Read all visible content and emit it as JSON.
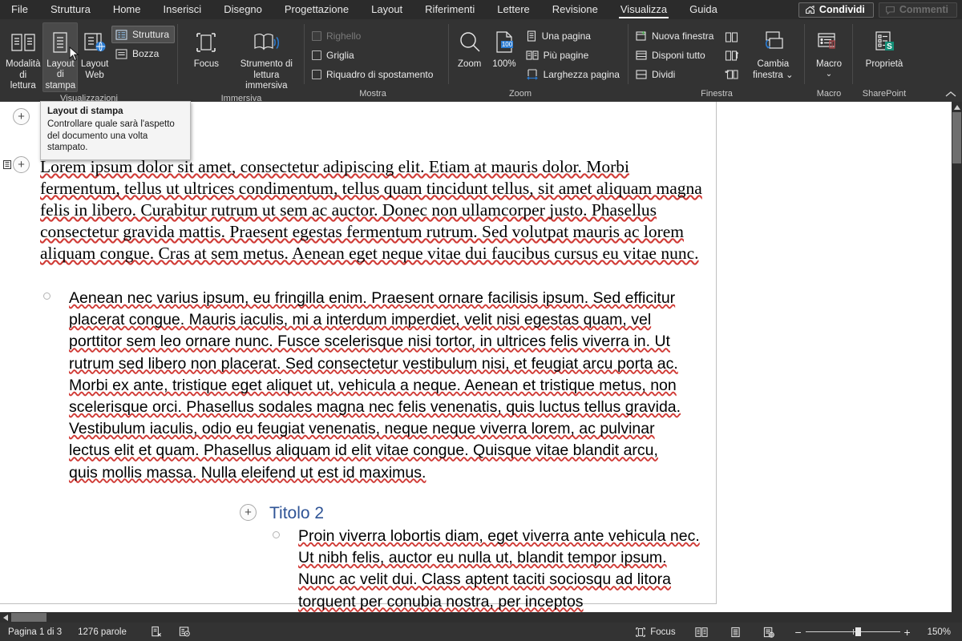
{
  "menu": {
    "tabs": [
      {
        "label": "File",
        "active": false
      },
      {
        "label": "Struttura",
        "active": false
      },
      {
        "label": "Home",
        "active": false
      },
      {
        "label": "Inserisci",
        "active": false
      },
      {
        "label": "Disegno",
        "active": false
      },
      {
        "label": "Progettazione",
        "active": false
      },
      {
        "label": "Layout",
        "active": false
      },
      {
        "label": "Riferimenti",
        "active": false
      },
      {
        "label": "Lettere",
        "active": false
      },
      {
        "label": "Revisione",
        "active": false
      },
      {
        "label": "Visualizza",
        "active": true
      },
      {
        "label": "Guida",
        "active": false
      }
    ],
    "share_label": "Condividi",
    "comments_label": "Commenti"
  },
  "ribbon": {
    "groups": [
      {
        "name": "Visualizzazioni",
        "label": "Visualizzazioni",
        "big_buttons": [
          {
            "label_line1": "Modalità",
            "label_line2": "di lettura",
            "icon": "read-mode-icon"
          },
          {
            "label_line1": "Layout di",
            "label_line2": "stampa",
            "icon": "print-layout-icon",
            "hover": true
          },
          {
            "label_line1": "Layout",
            "label_line2": "Web",
            "icon": "web-layout-icon"
          }
        ],
        "small_buttons": [
          {
            "label": "Struttura",
            "icon": "outline-icon",
            "selected": true,
            "disabled": false
          },
          {
            "label": "Bozza",
            "icon": "draft-icon",
            "selected": false,
            "disabled": false
          }
        ]
      },
      {
        "name": "Immersiva",
        "label": "Immersiva",
        "big_buttons": [
          {
            "label_line1": "Focus",
            "label_line2": "",
            "icon": "focus-icon"
          },
          {
            "label_line1": "Strumento di",
            "label_line2": "lettura immersiva",
            "icon": "immersive-reader-icon"
          }
        ],
        "small_buttons": []
      },
      {
        "name": "Mostra",
        "label": "Mostra",
        "big_buttons": [],
        "small_buttons": [
          {
            "label": "Righello",
            "icon": "checkbox",
            "selected": false,
            "disabled": true
          },
          {
            "label": "Griglia",
            "icon": "checkbox",
            "selected": false,
            "disabled": false
          },
          {
            "label": "Riquadro di spostamento",
            "icon": "checkbox",
            "selected": false,
            "disabled": false
          }
        ]
      },
      {
        "name": "Zoom",
        "label": "Zoom",
        "big_buttons": [
          {
            "label_line1": "Zoom",
            "label_line2": "",
            "icon": "magnifier-icon"
          },
          {
            "label_line1": "100%",
            "label_line2": "",
            "icon": "zoom-100-icon"
          }
        ],
        "small_buttons": [
          {
            "label": "Una pagina",
            "icon": "one-page-icon",
            "selected": false,
            "disabled": false
          },
          {
            "label": "Più pagine",
            "icon": "multi-page-icon",
            "selected": false,
            "disabled": false
          },
          {
            "label": "Larghezza pagina",
            "icon": "page-width-icon",
            "selected": false,
            "disabled": false
          }
        ]
      },
      {
        "name": "Finestra",
        "label": "Finestra",
        "big_buttons": [
          {
            "label_line1": "Cambia",
            "label_line2": "finestra ⌄",
            "icon": "switch-window-icon"
          }
        ],
        "small_buttons": [
          {
            "label": "Nuova finestra",
            "icon": "new-window-icon",
            "selected": false,
            "disabled": false
          },
          {
            "label": "Disponi tutto",
            "icon": "arrange-all-icon",
            "selected": false,
            "disabled": false
          },
          {
            "label": "Dividi",
            "icon": "split-icon",
            "selected": false,
            "disabled": false
          }
        ],
        "mini_icons": [
          "view-side-by-side-icon",
          "synchronous-scrolling-icon",
          "reset-window-position-icon"
        ]
      },
      {
        "name": "Macro",
        "label": "Macro",
        "big_buttons": [
          {
            "label_line1": "Macro",
            "label_line2": "⌄",
            "icon": "macro-icon"
          }
        ],
        "small_buttons": []
      },
      {
        "name": "SharePoint",
        "label": "SharePoint",
        "big_buttons": [
          {
            "label_line1": "Proprietà",
            "label_line2": "",
            "icon": "properties-icon"
          }
        ],
        "small_buttons": []
      }
    ]
  },
  "tooltip": {
    "title": "Layout di stampa",
    "body": "Controllare quale sarà l'aspetto del documento una volta stampato."
  },
  "document": {
    "paragraph1": "Lorem ipsum dolor sit amet, consectetur adipiscing elit. Etiam at mauris dolor. Morbi fermentum, tellus ut ultrices condimentum, tellus quam tincidunt tellus, sit amet aliquam magna felis in libero. Curabitur rutrum ut sem ac auctor. Donec non ullamcorper justo. Phasellus consectetur gravida mattis. Praesent egestas fermentum rutrum. Sed volutpat mauris ac lorem aliquam congue. Cras at sem metus. Aenean eget neque vitae dui faucibus cursus eu vitae nunc.",
    "paragraph2": "Aenean nec varius ipsum, eu fringilla enim. Praesent ornare facilisis ipsum. Sed efficitur placerat congue. Mauris iaculis, mi a interdum imperdiet, velit nisi egestas quam, vel porttitor sem leo ornare nunc. Fusce scelerisque nisi tortor, in ultrices felis viverra in. Ut rutrum sed libero non placerat. Sed consectetur vestibulum nisi, et feugiat arcu porta ac. Morbi ex ante, tristique eget aliquet ut, vehicula a neque. Aenean et tristique metus, non scelerisque orci. Phasellus sodales magna nec felis venenatis, quis luctus tellus gravida. Vestibulum iaculis, odio eu feugiat venenatis, neque neque viverra lorem, ac pulvinar lectus elit et quam. Phasellus aliquam id elit vitae congue. Quisque vitae blandit arcu, quis mollis massa. Nulla eleifend ut est id maximus.",
    "heading2": "Titolo 2",
    "paragraph3": "Proin viverra lobortis diam, eget viverra ante vehicula nec. Ut nibh felis, auctor eu nulla ut, blandit tempor ipsum. Nunc ac velit dui. Class aptent taciti sociosqu ad litora torquent per conubia nostra, per inceptos"
  },
  "status": {
    "page": "Pagina 1 di 3",
    "words": "1276 parole",
    "proofing_icon": "proofing-errors-icon",
    "accessibility_icon": "accessibility-checker-icon",
    "focus_label": "Focus",
    "view_read_icon": "read-mode-view-icon",
    "view_print_icon": "print-layout-view-icon",
    "view_web_icon": "web-layout-view-icon",
    "zoom_out": "−",
    "zoom_in": "+",
    "zoom_level": "150%"
  },
  "colors": {
    "ribbon_bg": "#333333",
    "menubar_bg": "#2b2b2b",
    "heading_blue": "#2f5496",
    "spell_red": "#d03a35",
    "grammar_blue": "#3a6fc4",
    "accent_blue": "#2b7cd3"
  }
}
